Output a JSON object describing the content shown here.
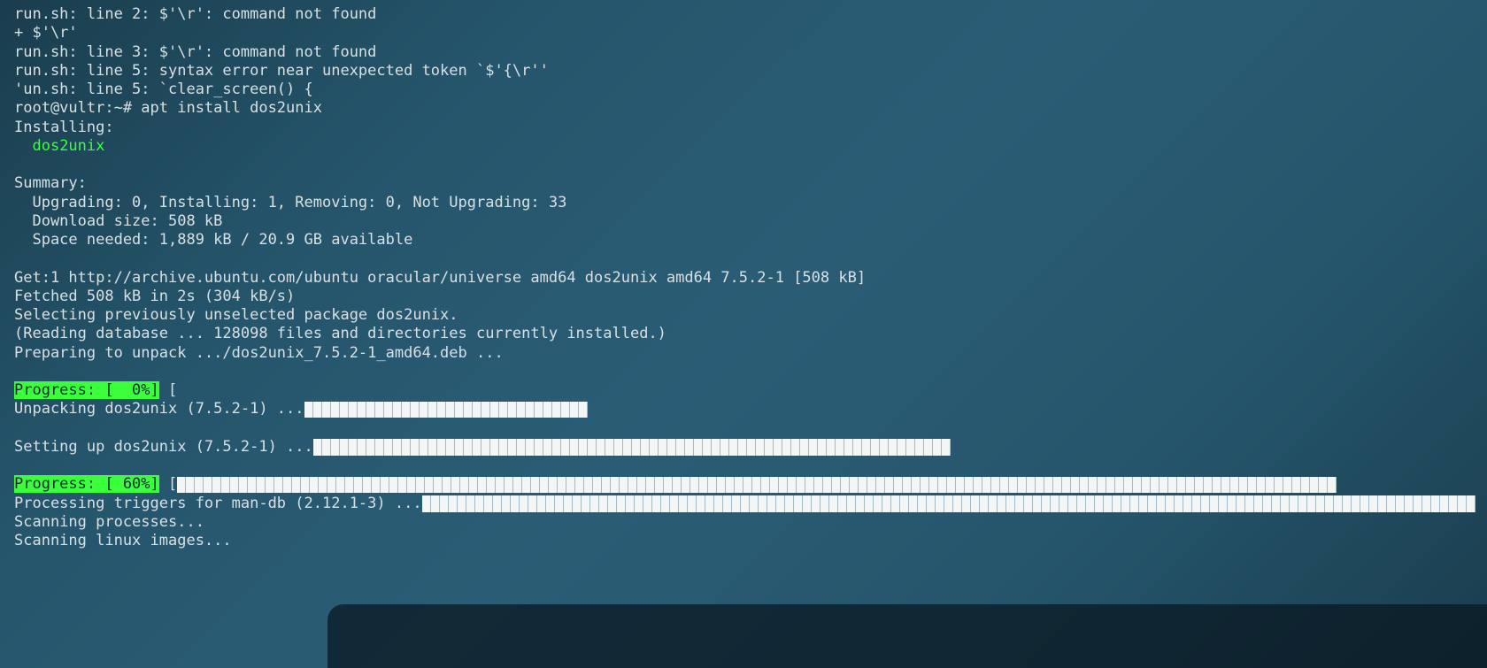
{
  "terminal": {
    "lines": [
      {
        "segs": [
          {
            "t": "run.sh: line 2: $'\\r': command not found"
          }
        ]
      },
      {
        "segs": [
          {
            "t": "+ $'\\r'"
          }
        ]
      },
      {
        "segs": [
          {
            "t": "run.sh: line 3: $'\\r': command not found"
          }
        ]
      },
      {
        "segs": [
          {
            "t": "run.sh: line 5: syntax error near unexpected token `$'{\\r''"
          }
        ]
      },
      {
        "segs": [
          {
            "t": "'un.sh: line 5: `clear_screen() {"
          }
        ]
      },
      {
        "segs": [
          {
            "t": "root@vultr:~# apt install dos2unix"
          }
        ]
      },
      {
        "segs": [
          {
            "t": "Installing:"
          }
        ]
      },
      {
        "segs": [
          {
            "t": "  "
          },
          {
            "t": "dos2unix",
            "c": "green"
          }
        ]
      },
      {
        "segs": [
          {
            "t": ""
          }
        ]
      },
      {
        "segs": [
          {
            "t": "Summary:"
          }
        ]
      },
      {
        "segs": [
          {
            "t": "  Upgrading: 0, Installing: 1, Removing: 0, Not Upgrading: 33"
          }
        ]
      },
      {
        "segs": [
          {
            "t": "  Download size: 508 kB"
          }
        ]
      },
      {
        "segs": [
          {
            "t": "  Space needed: 1,889 kB / 20.9 GB available"
          }
        ]
      },
      {
        "segs": [
          {
            "t": ""
          }
        ]
      },
      {
        "segs": [
          {
            "t": "Get:1 http://archive.ubuntu.com/ubuntu oracular/universe amd64 dos2unix amd64 7.5.2-1 [508 kB]"
          }
        ]
      },
      {
        "segs": [
          {
            "t": "Fetched 508 kB in 2s (304 kB/s)"
          }
        ]
      },
      {
        "segs": [
          {
            "t": "Selecting previously unselected package dos2unix."
          }
        ]
      },
      {
        "segs": [
          {
            "t": "(Reading database ... 128098 files and directories currently installed.)"
          }
        ]
      },
      {
        "segs": [
          {
            "t": "Preparing to unpack .../dos2unix_7.5.2-1_amd64.deb ..."
          }
        ]
      },
      {
        "segs": [
          {
            "t": ""
          }
        ]
      },
      {
        "segs": [
          {
            "t": "Progress: [  0%]",
            "c": "green-bg"
          },
          {
            "t": " ["
          }
        ]
      },
      {
        "segs": [
          {
            "t": "Unpacking dos2unix (7.5.2-1) ..."
          },
          {
            "bar": 320
          }
        ]
      },
      {
        "segs": [
          {
            "t": ""
          }
        ]
      },
      {
        "segs": [
          {
            "t": "Setting up dos2unix (7.5.2-1) ..."
          },
          {
            "bar": 720
          }
        ]
      },
      {
        "segs": [
          {
            "t": ""
          }
        ]
      },
      {
        "segs": [
          {
            "t": "Progress: [ 60%]",
            "c": "green-bg"
          },
          {
            "t": " ["
          },
          {
            "bar": 1310
          }
        ]
      },
      {
        "segs": [
          {
            "t": "Processing triggers for man-db (2.12.1-3) ..."
          },
          {
            "bar": 1190
          }
        ]
      },
      {
        "segs": [
          {
            "t": "Scanning processes..."
          }
        ]
      },
      {
        "segs": [
          {
            "t": "Scanning linux images..."
          }
        ]
      }
    ]
  }
}
